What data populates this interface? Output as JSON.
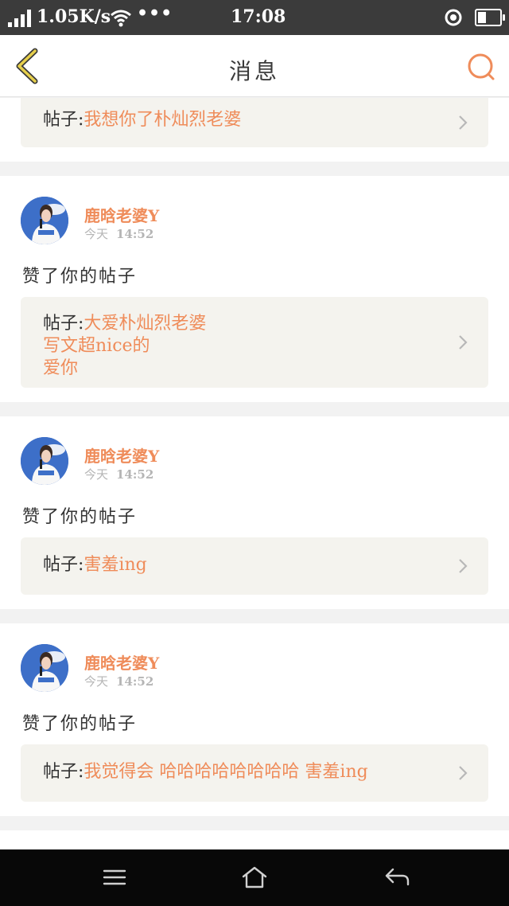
{
  "status_bar": {
    "network_speed": "1.05K/s",
    "more": "•••",
    "time": "17:08",
    "battery_level": 0.4
  },
  "header": {
    "title": "消息"
  },
  "first_post": {
    "label": "帖子:",
    "title": "我想你了朴灿烈老婆"
  },
  "notifications": [
    {
      "user": "鹿晗老婆Y",
      "day": "今天",
      "time": "14:52",
      "action": "赞了你的帖子",
      "post_label": "帖子:",
      "post_lines": [
        "大爱朴灿烈老婆",
        "写文超nice的",
        "爱你"
      ]
    },
    {
      "user": "鹿晗老婆Y",
      "day": "今天",
      "time": "14:52",
      "action": "赞了你的帖子",
      "post_label": "帖子:",
      "post_lines": [
        "害羞ing"
      ]
    },
    {
      "user": "鹿晗老婆Y",
      "day": "今天",
      "time": "14:52",
      "action": "赞了你的帖子",
      "post_label": "帖子:",
      "post_lines": [
        "我觉得会 哈哈哈哈哈哈哈哈 害羞ing"
      ]
    }
  ],
  "colors": {
    "accent": "#ef8c5a",
    "back_arrow": "#c9a83a",
    "post_bg": "#f4f3ee"
  },
  "icons": {
    "back": "back-chevron-icon",
    "search": "search-icon",
    "chevron": "chevron-right-icon",
    "menu": "menu-icon",
    "home": "home-icon",
    "return": "return-icon"
  }
}
